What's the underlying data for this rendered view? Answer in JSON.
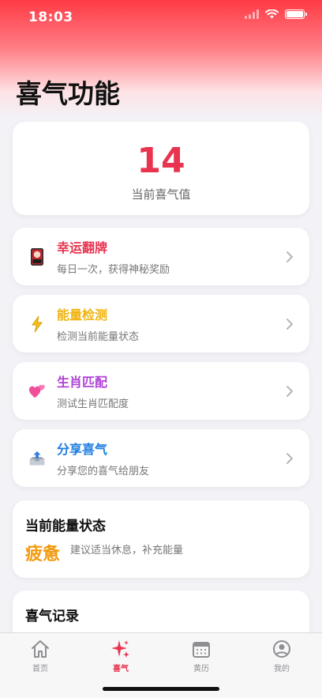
{
  "status_bar": {
    "time": "18:03"
  },
  "header": {
    "title": "喜气功能"
  },
  "value_card": {
    "value": "14",
    "label": "当前喜气值"
  },
  "features": [
    {
      "title": "幸运翻牌",
      "subtitle": "每日一次，获得神秘奖励",
      "color": "#e8344f",
      "icon": "lucky-card-icon"
    },
    {
      "title": "能量检测",
      "subtitle": "检测当前能量状态",
      "color": "#f0b20c",
      "icon": "lightning-icon"
    },
    {
      "title": "生肖匹配",
      "subtitle": "测试生肖匹配度",
      "color": "#b042d6",
      "icon": "two-hearts-icon"
    },
    {
      "title": "分享喜气",
      "subtitle": "分享您的喜气给朋友",
      "color": "#1f7de0",
      "icon": "outbox-tray-icon"
    }
  ],
  "energy": {
    "heading": "当前能量状态",
    "status": "疲惫",
    "tip": "建议适当休息，补充能量",
    "status_color": "#f29b12"
  },
  "records": {
    "heading": "喜气记录"
  },
  "tabs": [
    {
      "label": "首页",
      "icon": "home-icon",
      "active": false
    },
    {
      "label": "喜气",
      "icon": "sparkle-icon",
      "active": true
    },
    {
      "label": "黄历",
      "icon": "calendar-icon",
      "active": false
    },
    {
      "label": "我的",
      "icon": "profile-icon",
      "active": false
    }
  ],
  "colors": {
    "accent": "#e8344f",
    "header_gradient_top": "#ff3a45"
  }
}
